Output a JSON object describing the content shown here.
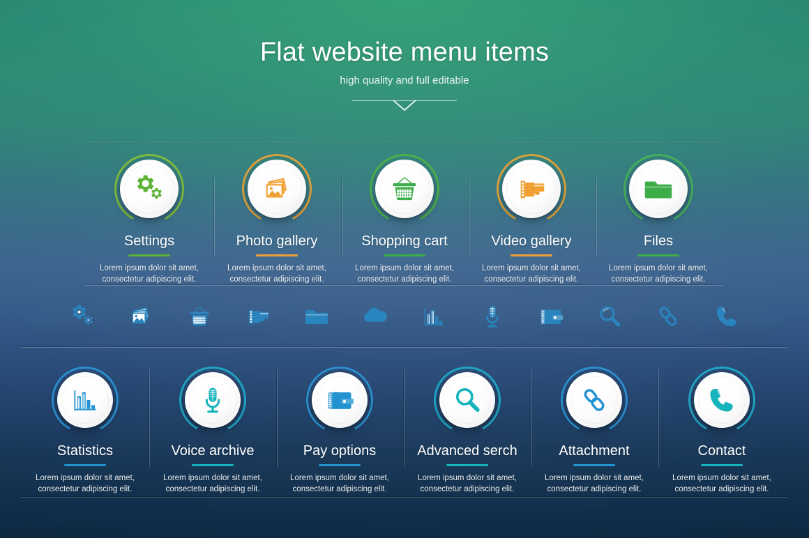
{
  "header": {
    "title": "Flat website menu items",
    "subtitle": "high quality and full editable"
  },
  "colors": {
    "green": "#5cb335",
    "green_dark": "#3cad49",
    "orange": "#f0a033",
    "blue": "#2292d0",
    "teal": "#17b3bd",
    "bg_top": "#2b8a72",
    "bg_mid": "#3a628d",
    "bg_bottom": "#0e2a45"
  },
  "description_text": "Lorem ipsum dolor sit amet,\nconsectetur adipiscing elit.",
  "row_top": [
    {
      "label": "Settings",
      "icon": "gear-icon",
      "color": "#5cb335",
      "arc": "#7dbb3f",
      "desc": "Lorem ipsum dolor sit amet,\nconsectetur adipiscing elit."
    },
    {
      "label": "Photo gallery",
      "icon": "photos-icon",
      "color": "#f0a033",
      "arc": "#d9a13f",
      "desc": "Lorem ipsum dolor sit amet,\nconsectetur adipiscing elit."
    },
    {
      "label": "Shopping cart",
      "icon": "basket-icon",
      "color": "#3cad49",
      "arc": "#4cb04a",
      "desc": "Lorem ipsum dolor sit amet,\nconsectetur adipiscing elit."
    },
    {
      "label": "Video gallery",
      "icon": "film-icon",
      "color": "#f0a033",
      "arc": "#d9a13f",
      "desc": "Lorem ipsum dolor sit amet,\nconsectetur adipiscing elit."
    },
    {
      "label": "Files",
      "icon": "folder-icon",
      "color": "#3cad49",
      "arc": "#45b05c",
      "desc": "Lorem ipsum dolor sit amet,\nconsectetur adipiscing elit."
    }
  ],
  "strip_icons": [
    "gear-icon",
    "photos-icon",
    "basket-icon",
    "film-icon",
    "folder-icon",
    "cloud-icon",
    "chart-icon",
    "microphone-icon",
    "wallet-icon",
    "magnifier-icon",
    "link-icon",
    "phone-icon"
  ],
  "row_bottom": [
    {
      "label": "Statistics",
      "icon": "chart-icon",
      "color": "#2292d0",
      "arc": "#2b8fd0",
      "desc": "Lorem ipsum dolor sit amet,\nconsectetur adipiscing elit."
    },
    {
      "label": "Voice archive",
      "icon": "microphone-icon",
      "color": "#17b3bd",
      "arc": "#1fa6c4",
      "desc": "Lorem ipsum dolor sit amet,\nconsectetur adipiscing elit."
    },
    {
      "label": "Pay options",
      "icon": "wallet-icon",
      "color": "#2292d0",
      "arc": "#2b8fd0",
      "desc": "Lorem ipsum dolor sit amet,\nconsectetur adipiscing elit."
    },
    {
      "label": "Advanced serch",
      "icon": "magnifier-icon",
      "color": "#17b3bd",
      "arc": "#1fa6c4",
      "desc": "Lorem ipsum dolor sit amet,\nconsectetur adipiscing elit."
    },
    {
      "label": "Attachment",
      "icon": "link-icon",
      "color": "#2292d0",
      "arc": "#2b8fd0",
      "desc": "Lorem ipsum dolor sit amet,\nconsectetur adipiscing elit."
    },
    {
      "label": "Contact",
      "icon": "phone-icon",
      "color": "#17b3bd",
      "arc": "#1fa6c4",
      "desc": "Lorem ipsum dolor sit amet,\nconsectetur adipiscing elit."
    }
  ]
}
